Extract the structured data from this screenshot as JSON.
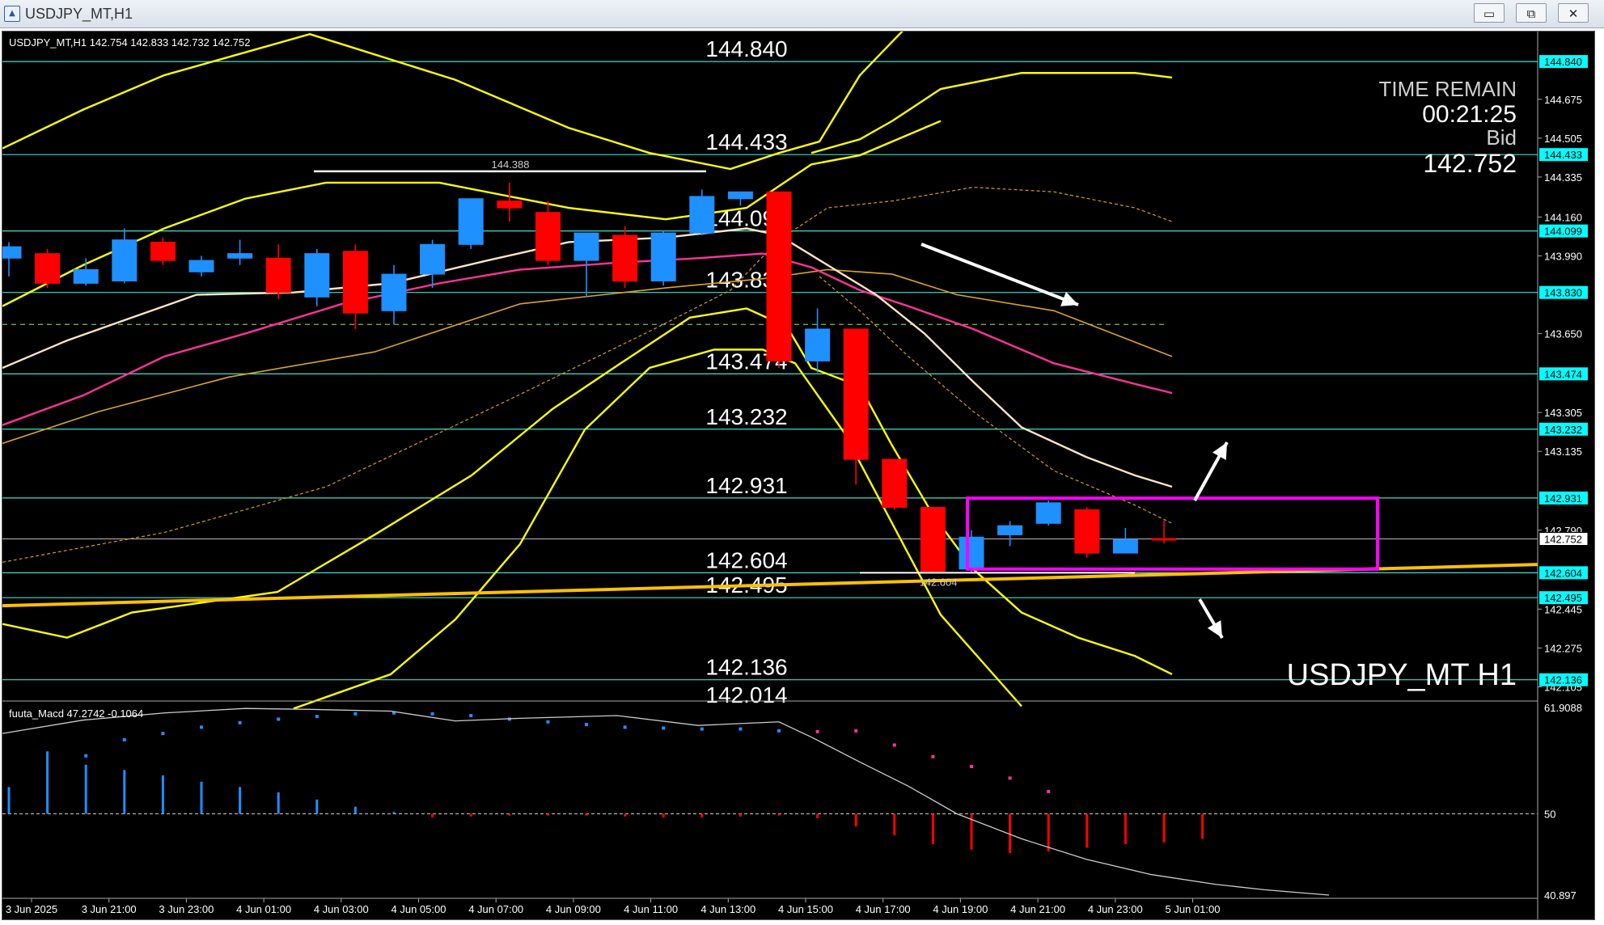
{
  "window": {
    "title": "USDJPY_MT,H1",
    "minimize_glyph": "▭",
    "restore_glyph": "⧉",
    "close_glyph": "✕",
    "icon_glyph": "▲"
  },
  "info_line": "USDJPY_MT,H1  142.754 142.833 142.732 142.752",
  "symbol_watermark": "USDJPY_MT H1",
  "time_remain": {
    "label": "TIME REMAIN",
    "value": "00:21:25",
    "bid_label": "Bid",
    "bid_value": "142.752"
  },
  "indicator_label": "fuuta_Macd 47.2742  -0.1064",
  "colors": {
    "background": "#000000",
    "bull_candle": "#1e90ff",
    "bear_candle": "#ff0000",
    "level_line": "#40e0d0",
    "bollinger": "#ffff00",
    "ma_pink": "#ff3399",
    "ma_white": "#ffe4c4",
    "ma_orange": "#daa520",
    "trend_yellow": "#ffc000",
    "range_box": "#ff00ff",
    "current_price_box": "#ffffff",
    "level_label_bg": "#00ffff"
  },
  "chart_data": {
    "type": "candlestick",
    "symbol": "USDJPY_MT",
    "timeframe": "H1",
    "ylim": [
      142.05,
      144.95
    ],
    "price_axis_ticks": [
      "144.675",
      "144.505",
      "144.335",
      "144.160",
      "143.990",
      "143.650",
      "143.305",
      "143.135",
      "142.790",
      "142.445",
      "142.275",
      "142.105"
    ],
    "time_labels": [
      "3 Jun 2025",
      "3 Jun 21:00",
      "3 Jun 23:00",
      "4 Jun 01:00",
      "4 Jun 03:00",
      "4 Jun 05:00",
      "4 Jun 07:00",
      "4 Jun 09:00",
      "4 Jun 11:00",
      "4 Jun 13:00",
      "4 Jun 15:00",
      "4 Jun 17:00",
      "4 Jun 19:00",
      "4 Jun 21:00",
      "4 Jun 23:00",
      "5 Jun 01:00"
    ],
    "horizontal_levels": [
      "144.840",
      "144.433",
      "144.099",
      "143.830",
      "143.474",
      "143.232",
      "142.931",
      "142.604",
      "142.495",
      "142.136",
      "142.014"
    ],
    "level_tag_values": [
      "144.840",
      "144.433",
      "144.099",
      "143.830",
      "143.474",
      "143.232",
      "142.931",
      "142.604",
      "142.495",
      "142.136"
    ],
    "current_price": "142.752",
    "swing_high_label": "144.388",
    "swing_low_label": "142.604",
    "candles": [
      {
        "o": 143.98,
        "h": 144.05,
        "c": 144.03,
        "l": 143.9
      },
      {
        "o": 144.0,
        "h": 144.02,
        "c": 143.87,
        "l": 143.85
      },
      {
        "o": 143.87,
        "h": 143.98,
        "c": 143.93,
        "l": 143.86
      },
      {
        "o": 143.88,
        "h": 144.11,
        "c": 144.06,
        "l": 143.87
      },
      {
        "o": 144.05,
        "h": 144.07,
        "c": 143.97,
        "l": 143.95
      },
      {
        "o": 143.92,
        "h": 143.99,
        "c": 143.97,
        "l": 143.9
      },
      {
        "o": 143.98,
        "h": 144.06,
        "c": 144.0,
        "l": 143.95
      },
      {
        "o": 143.98,
        "h": 144.04,
        "c": 143.83,
        "l": 143.8
      },
      {
        "o": 143.81,
        "h": 144.02,
        "c": 144.0,
        "l": 143.77
      },
      {
        "o": 144.01,
        "h": 144.04,
        "c": 143.74,
        "l": 143.67
      },
      {
        "o": 143.75,
        "h": 143.95,
        "c": 143.91,
        "l": 143.69
      },
      {
        "o": 143.91,
        "h": 144.06,
        "c": 144.04,
        "l": 143.85
      },
      {
        "o": 144.04,
        "h": 144.24,
        "c": 144.24,
        "l": 144.02
      },
      {
        "o": 144.23,
        "h": 144.31,
        "c": 144.2,
        "l": 144.14
      },
      {
        "o": 144.18,
        "h": 144.23,
        "c": 143.97,
        "l": 143.95
      },
      {
        "o": 143.97,
        "h": 144.07,
        "c": 144.09,
        "l": 143.81
      },
      {
        "o": 144.08,
        "h": 144.12,
        "c": 143.88,
        "l": 143.85
      },
      {
        "o": 143.88,
        "h": 144.1,
        "c": 144.09,
        "l": 143.86
      },
      {
        "o": 144.09,
        "h": 144.28,
        "c": 144.25,
        "l": 144.08
      },
      {
        "o": 144.24,
        "h": 144.27,
        "c": 144.27,
        "l": 144.21
      },
      {
        "o": 144.27,
        "h": 144.27,
        "c": 143.53,
        "l": 143.5
      },
      {
        "o": 143.53,
        "h": 143.76,
        "c": 143.67,
        "l": 143.48
      },
      {
        "o": 143.67,
        "h": 143.67,
        "c": 143.1,
        "l": 142.99
      },
      {
        "o": 143.1,
        "h": 143.1,
        "c": 142.89,
        "l": 142.88
      },
      {
        "o": 142.89,
        "h": 142.89,
        "c": 142.61,
        "l": 142.604
      },
      {
        "o": 142.62,
        "h": 142.79,
        "c": 142.76,
        "l": 142.604
      },
      {
        "o": 142.77,
        "h": 142.83,
        "c": 142.81,
        "l": 142.72
      },
      {
        "o": 142.82,
        "h": 142.92,
        "c": 142.91,
        "l": 142.81
      },
      {
        "o": 142.88,
        "h": 142.89,
        "c": 142.69,
        "l": 142.67
      },
      {
        "o": 142.69,
        "h": 142.8,
        "c": 142.75,
        "l": 142.69
      },
      {
        "o": 142.754,
        "h": 142.833,
        "c": 142.752,
        "l": 142.732
      }
    ],
    "indicator": {
      "name": "fuuta_Macd",
      "values": [
        "47.2742",
        "-0.1064"
      ],
      "ylim_labels": [
        "61.9088",
        "50",
        "40.897"
      ]
    }
  }
}
